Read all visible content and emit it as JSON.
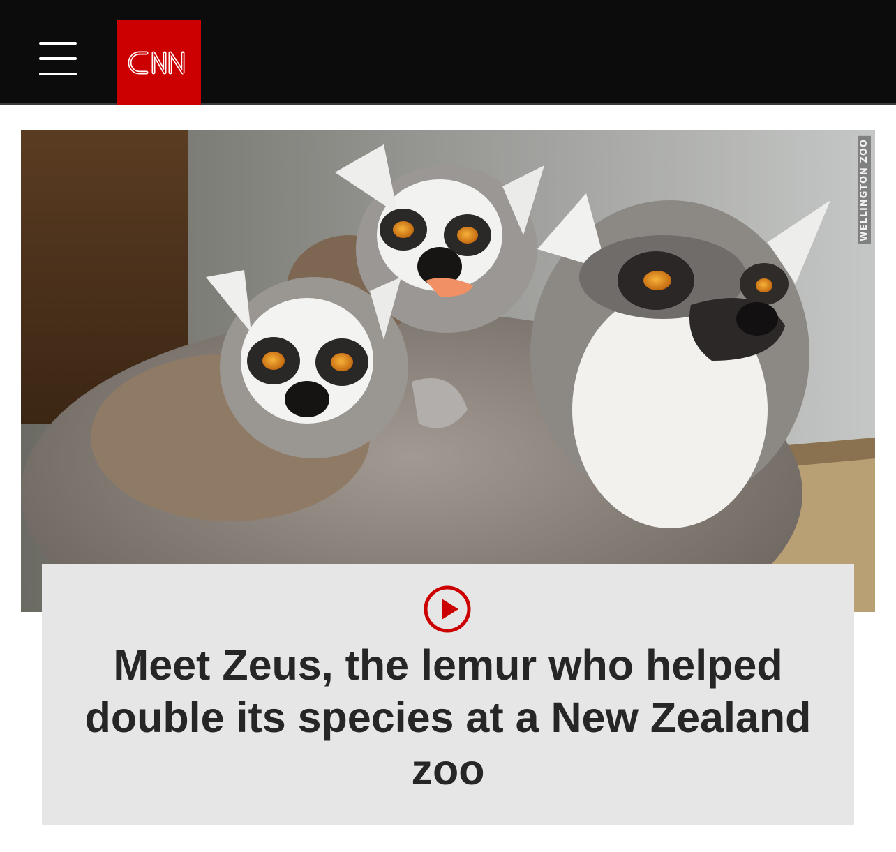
{
  "header": {
    "menu_icon": "hamburger-menu-icon",
    "logo_text": "CNN",
    "logo_color": "#cc0000",
    "background": "#0c0c0c"
  },
  "hero": {
    "image_content": "three ring-tailed lemurs, two babies on an adult's back",
    "credit": "WELLINGTON ZOO"
  },
  "card": {
    "play_icon": "play-circle-icon",
    "accent": "#cc0000",
    "headline": "Meet Zeus, the lemur who helped double its species at a New Zealand zoo"
  }
}
